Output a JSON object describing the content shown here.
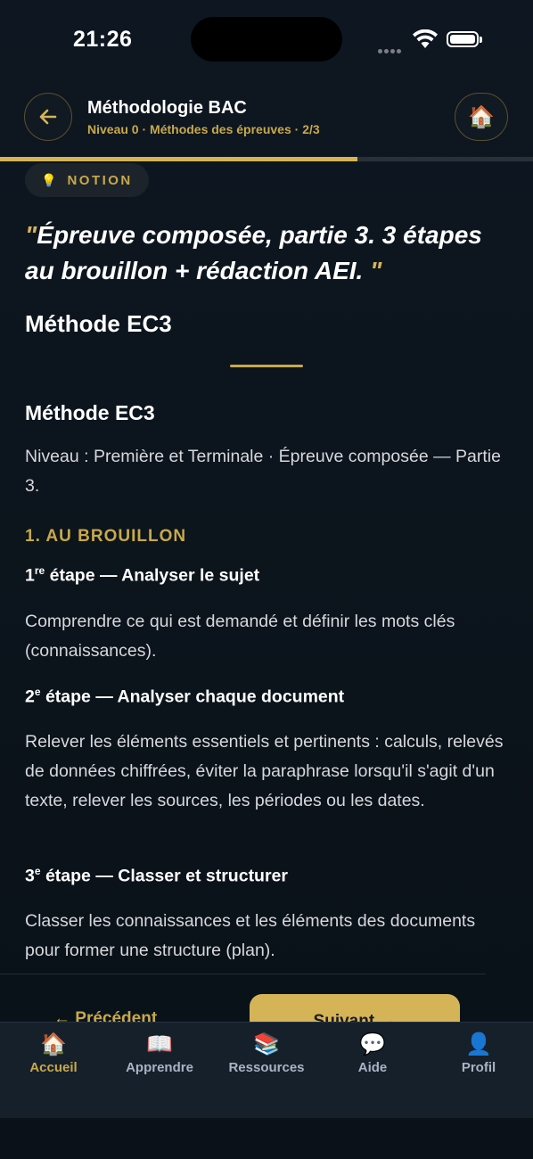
{
  "status_bar": {
    "time": "21:26"
  },
  "header": {
    "title": "Méthodologie BAC",
    "subtitle": "Niveau 0 · Méthodes des épreuves · 2/3",
    "progress": 0.67
  },
  "icons": {
    "back": "arrow-left-icon",
    "home": "house-icon",
    "bulb": "lightbulb-icon"
  },
  "badge": {
    "label": "NOTION"
  },
  "quote": {
    "open": "\"",
    "text": "Épreuve composée, partie 3. 3 étapes au brouillon + rédaction AEI. ",
    "close": "\""
  },
  "content": {
    "title": "Méthode EC3",
    "subtitle": "Méthode EC3",
    "intro": "Niveau : Première et Terminale · Épreuve composée — Partie 3.",
    "section1": "1. AU BROUILLON",
    "steps": [
      {
        "num": "1",
        "sup": "re",
        "title": " étape — Analyser le sujet",
        "text": "Comprendre ce qui est demandé et définir les mots clés (connaissances)."
      },
      {
        "num": "2",
        "sup": "e",
        "title": " étape — Analyser chaque document",
        "text": "Relever les éléments essentiels et pertinents : calculs, relevés de données chiffrées, éviter la paraphrase lorsqu'il s'agit d'un texte, relever les sources, les périodes ou les dates."
      },
      {
        "num": "3",
        "sup": "e",
        "title": " étape — Classer et structurer",
        "text": "Classer les connaissances et les éléments des documents pour former une structure (plan)."
      }
    ]
  },
  "nav_buttons": {
    "previous": "← Précédent",
    "next": "Suivant →"
  },
  "tabbar": {
    "items": [
      {
        "label": "Accueil",
        "icon": "house-icon",
        "glyph": "🏠"
      },
      {
        "label": "Apprendre",
        "icon": "open-book-icon",
        "glyph": "📖"
      },
      {
        "label": "Ressources",
        "icon": "books-icon",
        "glyph": "📚"
      },
      {
        "label": "Aide",
        "icon": "speech-bubble-icon",
        "glyph": "💬"
      },
      {
        "label": "Profil",
        "icon": "user-icon",
        "glyph": "👤"
      }
    ]
  }
}
